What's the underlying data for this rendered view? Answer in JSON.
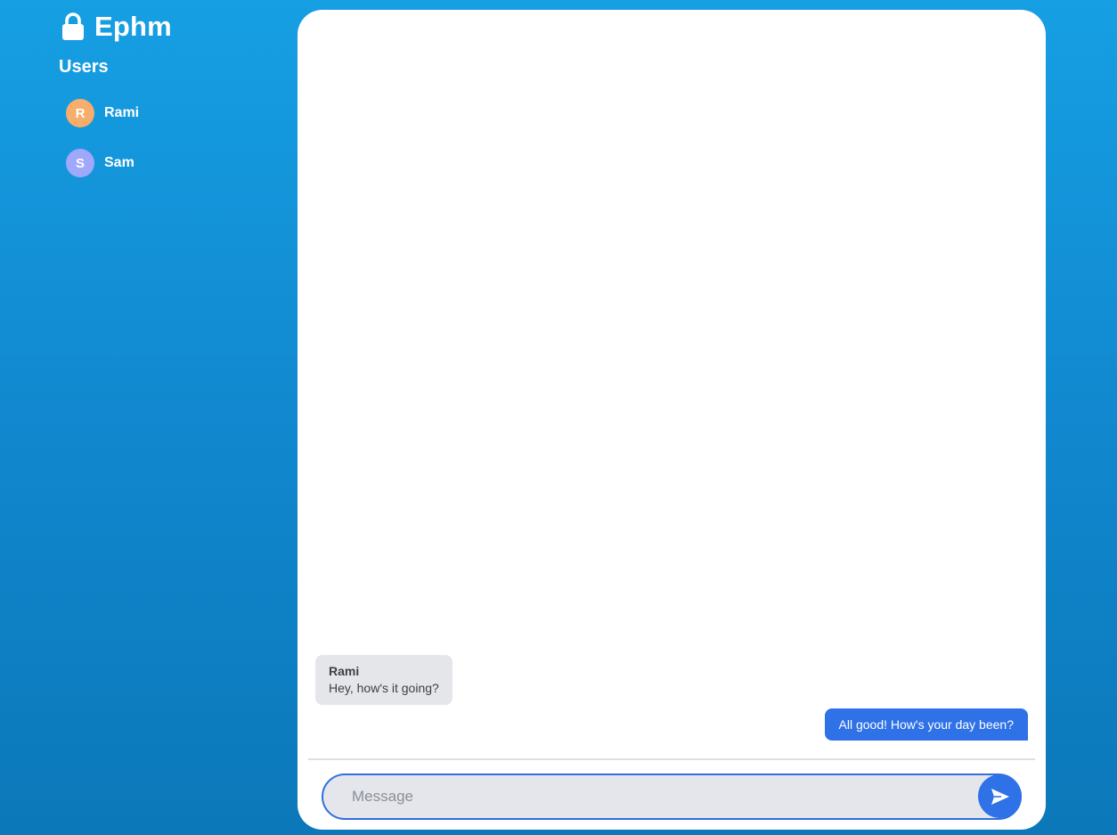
{
  "app": {
    "title": "Ephm",
    "logo_icon": "lock-icon"
  },
  "sidebar": {
    "heading": "Users",
    "users": [
      {
        "initial": "R",
        "name": "Rami",
        "color": "#f7ad6b"
      },
      {
        "initial": "S",
        "name": "Sam",
        "color": "#a0a8fb"
      }
    ]
  },
  "chat": {
    "messages": [
      {
        "direction": "incoming",
        "sender": "Rami",
        "text": "Hey, how's it going?"
      },
      {
        "direction": "outgoing",
        "text": "All good! How's your day been?"
      }
    ],
    "composer": {
      "placeholder": "Message",
      "value": "",
      "send_icon": "send-icon"
    }
  },
  "colors": {
    "background_top": "#169fe3",
    "background_bottom": "#0b78b9",
    "accent": "#2f71e6",
    "incoming_bubble": "#e4e6ea"
  }
}
